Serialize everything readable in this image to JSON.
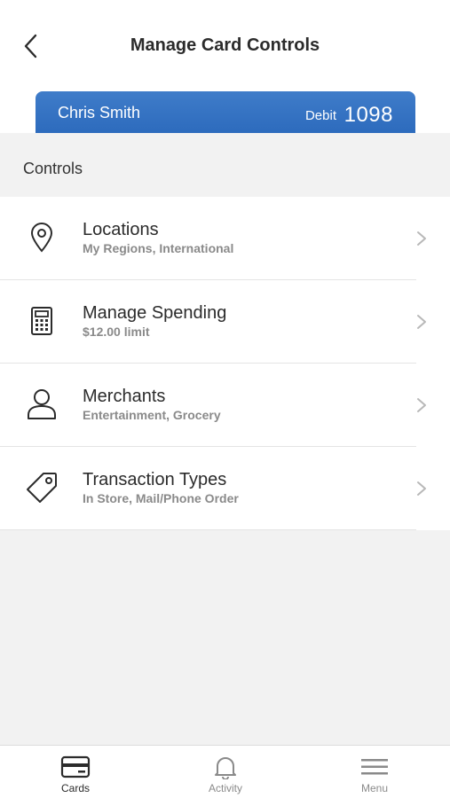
{
  "header": {
    "title": "Manage Card Controls",
    "back_icon": "chevron-left-icon"
  },
  "card": {
    "holder_name": "Chris Smith",
    "type": "Debit",
    "last4": "1098",
    "color": "#3a76c5"
  },
  "section": {
    "label": "Controls"
  },
  "controls": [
    {
      "icon": "location-pin-icon",
      "title": "Locations",
      "subtitle": "My Regions, International"
    },
    {
      "icon": "calculator-icon",
      "title": "Manage Spending",
      "subtitle": "$12.00 limit"
    },
    {
      "icon": "person-icon",
      "title": "Merchants",
      "subtitle": "Entertainment, Grocery"
    },
    {
      "icon": "tag-icon",
      "title": "Transaction Types",
      "subtitle": "In Store, Mail/Phone Order"
    }
  ],
  "tabbar": {
    "tabs": [
      {
        "label": "Cards",
        "icon": "card-icon",
        "active": true
      },
      {
        "label": "Activity",
        "icon": "bell-icon",
        "active": false
      },
      {
        "label": "Menu",
        "icon": "hamburger-icon",
        "active": false
      }
    ]
  },
  "colors": {
    "background": "#f2f2f2",
    "card_blue": "#3a76c5",
    "text_primary": "#2b2b2b",
    "text_secondary": "#8a8a8a"
  }
}
